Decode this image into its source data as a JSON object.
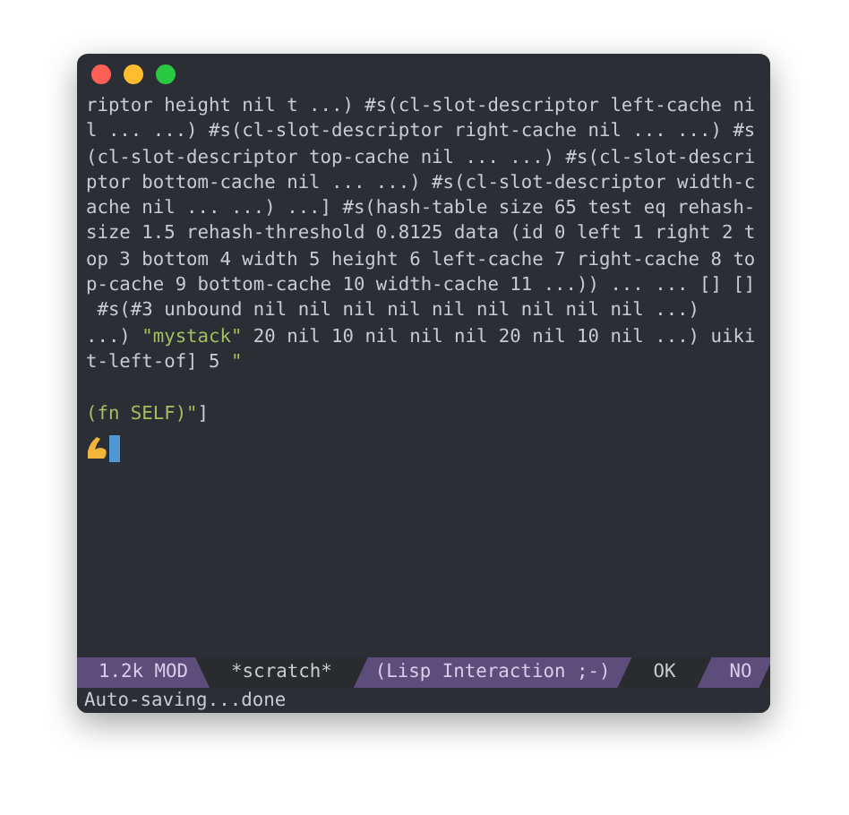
{
  "window": {
    "buttons": [
      {
        "kind": "close"
      },
      {
        "kind": "minimize"
      },
      {
        "kind": "zoom"
      }
    ]
  },
  "buffer": {
    "lines": [
      [
        {
          "kind": "code",
          "text": "riptor height nil t ...) #s(cl-slot-descriptor left-cache ni"
        }
      ],
      [
        {
          "kind": "code",
          "text": "l ... ...) #s(cl-slot-descriptor right-cache nil ... ...) #s"
        }
      ],
      [
        {
          "kind": "code",
          "text": "(cl-slot-descriptor top-cache nil ... ...) #s(cl-slot-descri"
        }
      ],
      [
        {
          "kind": "code",
          "text": "ptor bottom-cache nil ... ...) #s(cl-slot-descriptor width-c"
        }
      ],
      [
        {
          "kind": "code",
          "text": "ache nil ... ...) ...] #s(hash-table size 65 test eq rehash-"
        }
      ],
      [
        {
          "kind": "code",
          "text": "size 1.5 rehash-threshold 0.8125 data (id 0 left 1 right 2 t"
        }
      ],
      [
        {
          "kind": "code",
          "text": "op 3 bottom 4 width 5 height 6 left-cache 7 right-cache 8 to"
        }
      ],
      [
        {
          "kind": "code",
          "text": "p-cache 9 bottom-cache 10 width-cache 11 ...)) ... ... [] []"
        }
      ],
      [
        {
          "kind": "code",
          "text": " #s(#3 unbound nil nil nil nil nil nil nil nil nil ...)"
        }
      ],
      [
        {
          "kind": "code",
          "text": "...) "
        },
        {
          "kind": "string",
          "text": "\"mystack\""
        },
        {
          "kind": "code",
          "text": " 20 nil 10 nil nil nil 20 nil 10 nil ...) uiki"
        }
      ],
      [
        {
          "kind": "code",
          "text": "t-left-of] 5 "
        },
        {
          "kind": "string",
          "text": "\""
        }
      ]
    ],
    "after_blank_line": [
      [
        {
          "kind": "string",
          "text": "(fn SELF)\""
        },
        {
          "kind": "code",
          "text": "]"
        }
      ]
    ]
  },
  "mode_line": [
    {
      "kind": "accent",
      "text": "1.2k MOD"
    },
    {
      "kind": "plain",
      "text": "*scratch*"
    },
    {
      "kind": "accent",
      "text": "(Lisp Interaction ;-)"
    },
    {
      "kind": "plain",
      "text": "OK"
    },
    {
      "kind": "accent",
      "text": "NO"
    }
  ],
  "echo_area": "Auto-saving...done"
}
